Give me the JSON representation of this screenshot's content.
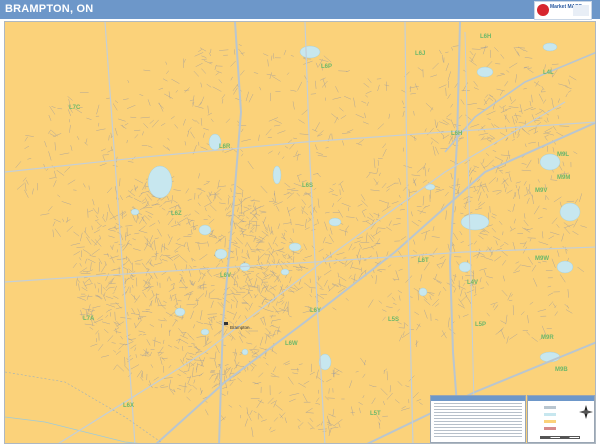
{
  "header": {
    "title": "BRAMPTON, ON",
    "logo_name": "market-maps-logo",
    "logo_text": "Market MAPS"
  },
  "map": {
    "land_color": "#fbd27a",
    "water_color": "#c7e7ef",
    "highway_color": "#b9c6d0",
    "label_color": "#6db86a",
    "postal_labels": [
      {
        "id": "L6J",
        "text": "L6J"
      },
      {
        "id": "L6H",
        "text": "L6H"
      },
      {
        "id": "L6P",
        "text": "L6P"
      },
      {
        "id": "L4L",
        "text": "L4L"
      },
      {
        "id": "L7C",
        "text": "L7C"
      },
      {
        "id": "L6H2",
        "text": "L6H"
      },
      {
        "id": "L6R",
        "text": "L6R"
      },
      {
        "id": "M9L",
        "text": "M9L"
      },
      {
        "id": "M9M",
        "text": "M9M"
      },
      {
        "id": "L6S",
        "text": "L6S"
      },
      {
        "id": "M9V",
        "text": "M9V"
      },
      {
        "id": "L6Z",
        "text": "L6Z"
      },
      {
        "id": "M9W",
        "text": "M9W"
      },
      {
        "id": "L6V",
        "text": "L6V"
      },
      {
        "id": "L6T",
        "text": "L6T"
      },
      {
        "id": "L4V",
        "text": "L4V"
      },
      {
        "id": "L7A",
        "text": "L7A"
      },
      {
        "id": "L6Y",
        "text": "L6Y"
      },
      {
        "id": "L5S",
        "text": "L5S"
      },
      {
        "id": "L6W",
        "text": "L6W"
      },
      {
        "id": "L5P",
        "text": "L5P"
      },
      {
        "id": "M9R",
        "text": "M9R"
      },
      {
        "id": "L6X",
        "text": "L6X"
      },
      {
        "id": "M9B",
        "text": "M9B"
      },
      {
        "id": "L5T",
        "text": "L5T"
      }
    ],
    "city_label": "Brampton"
  }
}
